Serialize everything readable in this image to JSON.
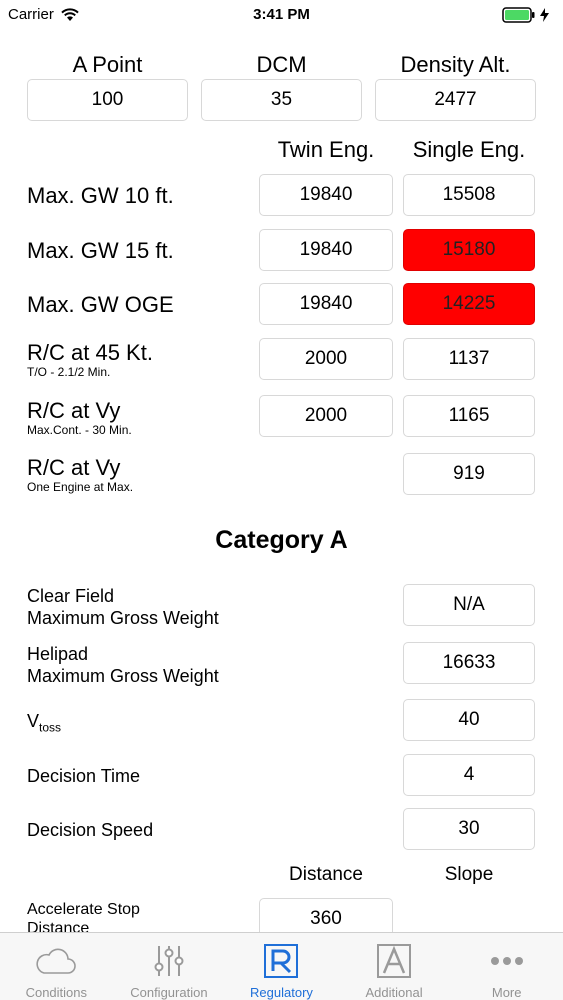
{
  "status_bar": {
    "carrier": "Carrier",
    "time": "3:41 PM"
  },
  "top": {
    "a_point_label": "A Point",
    "a_point_value": "100",
    "dcm_label": "DCM",
    "dcm_value": "35",
    "density_alt_label": "Density Alt.",
    "density_alt_value": "2477"
  },
  "columns": {
    "twin": "Twin Eng.",
    "single": "Single Eng."
  },
  "rows": [
    {
      "label": "Max. GW 10 ft.",
      "sub": "",
      "twin": "19840",
      "single": "15508"
    },
    {
      "label": "Max. GW 15 ft.",
      "sub": "",
      "twin": "19840",
      "single": "15180"
    },
    {
      "label": "Max. GW OGE",
      "sub": "",
      "twin": "19840",
      "single": "14225"
    },
    {
      "label": "R/C at 45 Kt.",
      "sub": "T/O - 2.1/2 Min.",
      "twin": "2000",
      "single": "1137"
    },
    {
      "label": "R/C at Vy",
      "sub": "Max.Cont. - 30 Min.",
      "twin": "2000",
      "single": "1165"
    },
    {
      "label": "R/C at Vy",
      "sub": "One Engine at Max.",
      "twin": "",
      "single": "919"
    }
  ],
  "category": {
    "title": "Category A",
    "clear_field_line1": "Clear Field",
    "clear_field_line2": "Maximum Gross Weight",
    "clear_field_value": "N/A",
    "helipad_line1": "Helipad",
    "helipad_line2": "Maximum Gross Weight",
    "helipad_value": "16633",
    "vtoss_main": "V",
    "vtoss_sub": "toss",
    "vtoss_value": "40",
    "decision_time_label": "Decision Time",
    "decision_time_value": "4",
    "decision_speed_label": "Decision Speed",
    "decision_speed_value": "30",
    "distance_header": "Distance",
    "slope_header": "Slope",
    "accel_stop_line1": "Accelerate Stop",
    "accel_stop_line2": "Distance",
    "accel_stop_value": "360"
  },
  "tabs": [
    {
      "label": "Conditions",
      "icon": "cloud-icon",
      "active": false
    },
    {
      "label": "Configuration",
      "icon": "sliders-icon",
      "active": false
    },
    {
      "label": "Regulatory",
      "icon": "regulatory-icon",
      "active": true
    },
    {
      "label": "Additional",
      "icon": "additional-icon",
      "active": false
    },
    {
      "label": "More",
      "icon": "more-icon",
      "active": false
    }
  ],
  "colors": {
    "accent": "#1f6fd8",
    "alert": "#ff0000",
    "battery": "#4cd964"
  }
}
